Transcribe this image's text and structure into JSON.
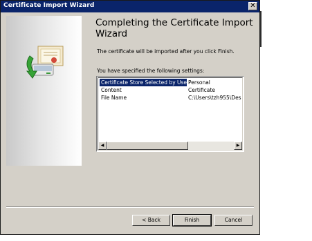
{
  "window": {
    "title": "Certificate Import Wizard",
    "close_glyph": "✕"
  },
  "content": {
    "heading": "Completing the Certificate Import Wizard",
    "description": "The certificate will be imported after you click Finish.",
    "settings_label": "You have specified the following settings:"
  },
  "settings": [
    {
      "name": "Certificate Store Selected by User",
      "value": "Personal",
      "selected": true
    },
    {
      "name": "Content",
      "value": "Certificate",
      "selected": false
    },
    {
      "name": "File Name",
      "value": "C:\\Users\\tzh955\\Des",
      "selected": false
    }
  ],
  "scroll": {
    "left_glyph": "◀",
    "right_glyph": "▶"
  },
  "buttons": {
    "back": "< Back",
    "finish": "Finish",
    "cancel": "Cancel"
  },
  "icons": {
    "wizard": "certificate-import-icon"
  },
  "colors": {
    "titlebar": "#0a246a",
    "selection": "#0a246a",
    "face": "#d4d0c8"
  }
}
